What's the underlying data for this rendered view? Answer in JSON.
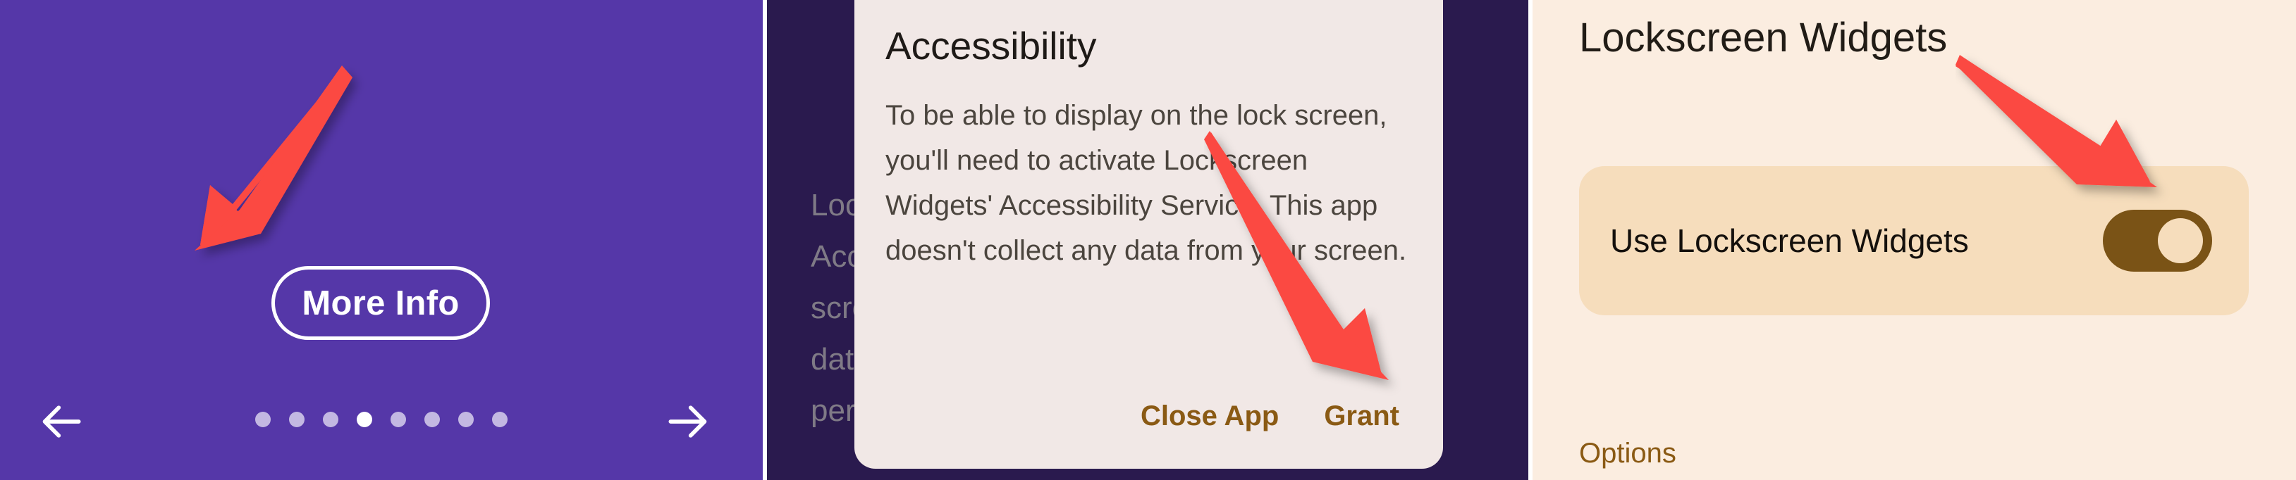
{
  "panels": {
    "onboarding": {
      "background_color": "#5537A8",
      "more_info_button_label": "More Info",
      "pager": {
        "total_dots": 8,
        "active_index": 3,
        "active_color": "#FFFFFF",
        "inactive_color": "#C3B8E2"
      },
      "nav": {
        "prev_icon": "arrow-left-icon",
        "next_icon": "arrow-right-icon"
      }
    },
    "accessibility": {
      "background_color": "#2A1A4E",
      "background_screen_text": "Loc                                                      ck\nAcc\nscre\ndat\nper",
      "dialog": {
        "background_color": "#F1E8E6",
        "title": "Accessibility",
        "body": "To be able to display on the lock screen, you'll need to activate Lockscreen Widgets' Accessibility Service. This app doesn't collect any data from your screen.",
        "action_color": "#8A5A14",
        "actions": [
          {
            "label": "Close App",
            "name": "close-app-button"
          },
          {
            "label": "Grant",
            "name": "grant-button"
          }
        ]
      }
    },
    "settings": {
      "background_color": "#FBEDE0",
      "title": "Lockscreen Widgets",
      "card": {
        "background_color": "#F6DDBC",
        "label": "Use Lockscreen Widgets",
        "toggle": {
          "state": "on",
          "track_color": "#7A5316",
          "knob_color": "#F6DDBC"
        }
      },
      "options_heading": "Options",
      "options_heading_color": "#8A5A14"
    }
  },
  "annotations": {
    "arrow_color": "#FB4A42",
    "arrows": [
      {
        "name": "arrow-to-more-info-button",
        "target": "More Info"
      },
      {
        "name": "arrow-to-grant-button",
        "target": "Grant"
      },
      {
        "name": "arrow-to-use-lockscreen-widgets-toggle",
        "target": "Use Lockscreen Widgets toggle"
      }
    ]
  }
}
